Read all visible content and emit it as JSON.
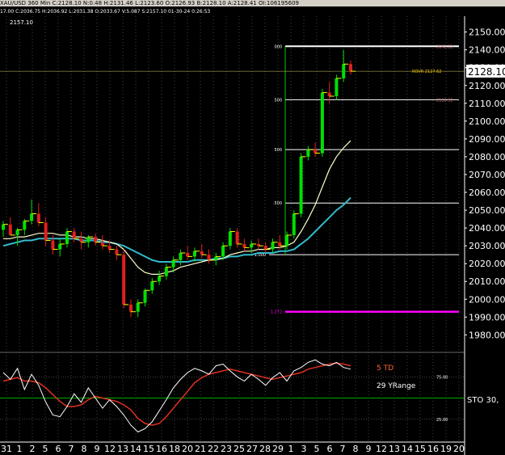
{
  "window": {
    "title": "XAU/USD  360 Min  C:2128.10  N:0.48  H:2131.46  L:2123.60  O:2126.93  B:2128.10  A:2128.41  OI:106195609",
    "subtitle": "17.00  C:2036.75  H:2036.92  L:2031.38  O:2033.67  V:5.087  S:2157.10  01-30-24  0:26:53"
  },
  "colors": {
    "background": "#000000",
    "bull": "#00e000",
    "bear": "#e02020",
    "ma_fast": "#ffffcc",
    "ma_slow": "#33bbcc",
    "fib_ext": "#ff00ff",
    "stoch_k": "#ffffff",
    "stoch_d": "#e03020",
    "grid": "#888888"
  },
  "chart_data": [
    {
      "type": "candlestick",
      "top_label": "2157.10",
      "last_price": "2128.10",
      "ylim": [
        1972,
        2158
      ],
      "y_ticks": [
        1980,
        1990,
        2000,
        2010,
        2020,
        2030,
        2040,
        2050,
        2060,
        2070,
        2080,
        2090,
        2100,
        2110,
        2120,
        2130,
        2140,
        2150
      ],
      "x_ticks": [
        "31",
        "1",
        "2",
        "5",
        "6",
        "7",
        "8",
        "9",
        "12",
        "13",
        "14",
        "15",
        "16",
        "18",
        "20",
        "21",
        "22",
        "23",
        "25",
        "27",
        "28",
        "29",
        "1",
        "3",
        "5",
        "6",
        "7",
        "8",
        "9",
        "12",
        "13",
        "14",
        "15",
        "16",
        "19",
        "20"
      ],
      "candles": [
        [
          2039,
          2044,
          2035,
          2042
        ],
        [
          2042,
          2046,
          2038,
          2036
        ],
        [
          2036,
          2040,
          2030,
          2039
        ],
        [
          2039,
          2045,
          2036,
          2044
        ],
        [
          2044,
          2056,
          2042,
          2048
        ],
        [
          2048,
          2054,
          2041,
          2043
        ],
        [
          2043,
          2046,
          2030,
          2033
        ],
        [
          2033,
          2036,
          2025,
          2028
        ],
        [
          2028,
          2034,
          2024,
          2031
        ],
        [
          2031,
          2040,
          2029,
          2038
        ],
        [
          2038,
          2040,
          2032,
          2034
        ],
        [
          2034,
          2038,
          2028,
          2032
        ],
        [
          2032,
          2036,
          2029,
          2035
        ],
        [
          2035,
          2037,
          2030,
          2032
        ],
        [
          2032,
          2036,
          2028,
          2030
        ],
        [
          2030,
          2033,
          2026,
          2028
        ],
        [
          2028,
          2030,
          2022,
          2025
        ],
        [
          2025,
          2028,
          1995,
          1997
        ],
        [
          1997,
          2000,
          1990,
          1993
        ],
        [
          1993,
          2000,
          1990,
          1998
        ],
        [
          1998,
          2006,
          1996,
          2005
        ],
        [
          2005,
          2012,
          2003,
          2010
        ],
        [
          2010,
          2016,
          2008,
          2013
        ],
        [
          2013,
          2020,
          2011,
          2018
        ],
        [
          2018,
          2024,
          2015,
          2022
        ],
        [
          2022,
          2028,
          2019,
          2026
        ],
        [
          2026,
          2030,
          2022,
          2024
        ],
        [
          2024,
          2029,
          2021,
          2027
        ],
        [
          2027,
          2031,
          2023,
          2025
        ],
        [
          2025,
          2028,
          2020,
          2022
        ],
        [
          2022,
          2026,
          2019,
          2024
        ],
        [
          2024,
          2032,
          2022,
          2030
        ],
        [
          2030,
          2040,
          2028,
          2038
        ],
        [
          2038,
          2040,
          2029,
          2031
        ],
        [
          2031,
          2034,
          2027,
          2029
        ],
        [
          2029,
          2033,
          2026,
          2031
        ],
        [
          2031,
          2034,
          2028,
          2030
        ],
        [
          2030,
          2032,
          2026,
          2028
        ],
        [
          2028,
          2034,
          2026,
          2032
        ],
        [
          2032,
          2036,
          2028,
          2030
        ],
        [
          2030,
          2038,
          2028,
          2036
        ],
        [
          2036,
          2050,
          2034,
          2048
        ],
        [
          2048,
          2082,
          2046,
          2080
        ],
        [
          2080,
          2086,
          2078,
          2084
        ],
        [
          2084,
          2088,
          2080,
          2082
        ],
        [
          2082,
          2118,
          2080,
          2116
        ],
        [
          2116,
          2122,
          2110,
          2114
        ],
        [
          2114,
          2126,
          2112,
          2124
        ],
        [
          2124,
          2140,
          2122,
          2132
        ],
        [
          2132,
          2134,
          2126,
          2128
        ]
      ],
      "ma_fast": [
        2034,
        2034,
        2035,
        2035,
        2036,
        2037,
        2037,
        2037,
        2036,
        2036,
        2035,
        2035,
        2034,
        2034,
        2033,
        2032,
        2031,
        2028,
        2023,
        2018,
        2015,
        2014,
        2014,
        2015,
        2016,
        2018,
        2019,
        2020,
        2021,
        2022,
        2022,
        2023,
        2025,
        2026,
        2027,
        2027,
        2028,
        2028,
        2029,
        2029,
        2030,
        2032,
        2038,
        2045,
        2053,
        2063,
        2073,
        2080,
        2085,
        2089
      ],
      "ma_slow": [
        2030,
        2031,
        2032,
        2033,
        2033,
        2034,
        2034,
        2034,
        2034,
        2034,
        2034,
        2033,
        2033,
        2033,
        2032,
        2032,
        2031,
        2030,
        2028,
        2026,
        2024,
        2022,
        2021,
        2021,
        2021,
        2021,
        2021,
        2022,
        2022,
        2022,
        2023,
        2023,
        2024,
        2024,
        2025,
        2025,
        2026,
        2026,
        2026,
        2027,
        2027,
        2028,
        2031,
        2034,
        2038,
        2042,
        2046,
        2050,
        2053,
        2057
      ],
      "fib_levels": [
        {
          "label": "000",
          "value": 2142,
          "color": "#ffffff"
        },
        {
          "label": "500",
          "value": 2112,
          "color": "#ffffff"
        },
        {
          "label": "500",
          "value": 2084,
          "color": "#ffffff"
        },
        {
          "label": ".500",
          "value": 2054,
          "color": "#ffffff"
        },
        {
          "label": "1.000",
          "value": 2025,
          "color": "#ffffff"
        },
        {
          "label": "1.272",
          "value": 1993,
          "color": "#ff00ff"
        }
      ],
      "annotations": [
        {
          "text": "ROVR  2127.62",
          "value": 2128
        },
        {
          "text": "2112.32",
          "value": 2112
        },
        {
          "text": "2142.12",
          "value": 2142
        }
      ]
    },
    {
      "type": "line",
      "indicator": "STO",
      "indicator_label": "STO  30,",
      "labels": [
        "5 TD",
        "29 YRange"
      ],
      "ylim": [
        0,
        100
      ],
      "y_ticks": [
        "75.00",
        "25.00"
      ],
      "bands": [
        75,
        50,
        25
      ],
      "k": [
        80,
        72,
        85,
        60,
        78,
        65,
        45,
        30,
        28,
        40,
        55,
        45,
        62,
        50,
        38,
        48,
        40,
        30,
        18,
        10,
        14,
        22,
        35,
        48,
        62,
        72,
        80,
        85,
        82,
        78,
        88,
        90,
        82,
        75,
        70,
        78,
        72,
        65,
        74,
        80,
        70,
        82,
        86,
        92,
        95,
        90,
        88,
        92,
        86,
        84
      ],
      "d": [
        70,
        72,
        74,
        70,
        70,
        68,
        62,
        54,
        46,
        40,
        40,
        42,
        48,
        52,
        50,
        48,
        46,
        42,
        36,
        26,
        20,
        18,
        20,
        28,
        38,
        48,
        58,
        68,
        74,
        78,
        80,
        82,
        84,
        82,
        80,
        78,
        76,
        74,
        72,
        74,
        76,
        78,
        80,
        84,
        86,
        88,
        90,
        91,
        90,
        88
      ]
    }
  ]
}
